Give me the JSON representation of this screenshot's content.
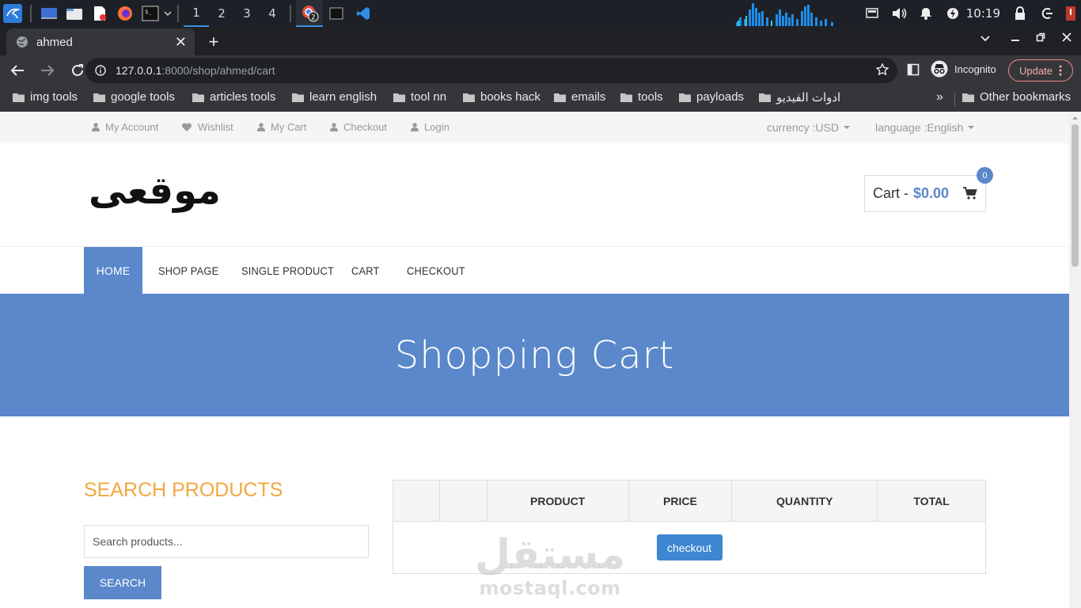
{
  "taskbar": {
    "workspaces": [
      "1",
      "2",
      "3",
      "4"
    ],
    "chrome_badge": "2",
    "clock": "10:19"
  },
  "browser": {
    "tab_title": "ahmed",
    "url_host": "127.0.0.1",
    "url_path": ":8000/shop/ahmed/cart",
    "incognito_label": "Incognito",
    "update_label": "Update",
    "bookmarks": [
      "img tools",
      "google tools",
      "articles tools",
      "learn english",
      "tool nn",
      "books hack",
      "emails",
      "tools",
      "payloads",
      "ادوات الفيديو"
    ],
    "bookmarks_overflow": "»",
    "other_bookmarks": "Other bookmarks"
  },
  "site": {
    "toplinks": [
      "My Account",
      "Wishlist",
      "My Cart",
      "Checkout",
      "Login"
    ],
    "currency": "currency :USD",
    "language": "language :English",
    "logo_text": "موقعى",
    "cart_label": "Cart -",
    "cart_amount": "$0.00",
    "cart_count": "0",
    "nav": [
      "HOME",
      "SHOP PAGE",
      "SINGLE PRODUCT",
      "CART",
      "CHECKOUT"
    ],
    "banner_title": "Shopping Cart",
    "sidebar_title": "SEARCH PRODUCTS",
    "search_placeholder": "Search products...",
    "search_button": "SEARCH",
    "table_headers": [
      "",
      "",
      "PRODUCT",
      "PRICE",
      "QUANTITY",
      "TOTAL"
    ],
    "checkout_button": "checkout",
    "watermark_ar": "مستقل",
    "watermark_en": "mostaql.com"
  },
  "colors": {
    "brand_blue": "#5a88ca",
    "accent_orange": "#f4a640",
    "checkout_blue": "#3d87d0"
  }
}
